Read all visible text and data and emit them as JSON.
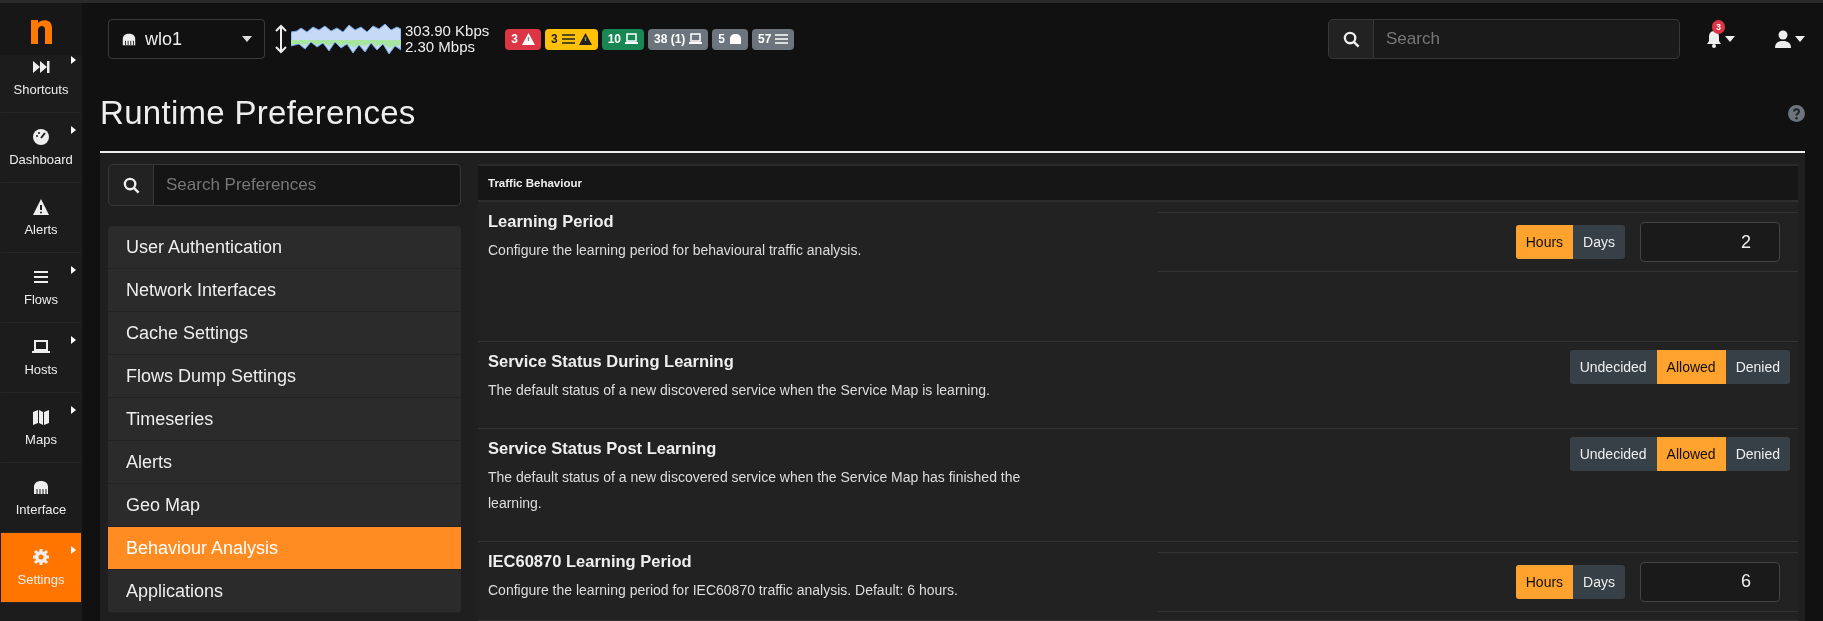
{
  "sidebar": {
    "items": [
      {
        "label": "Shortcuts",
        "submenu": true,
        "selected": false
      },
      {
        "label": "Dashboard",
        "submenu": true,
        "selected": false
      },
      {
        "label": "Alerts",
        "submenu": false,
        "selected": false
      },
      {
        "label": "Flows",
        "submenu": true,
        "selected": false
      },
      {
        "label": "Hosts",
        "submenu": true,
        "selected": false
      },
      {
        "label": "Maps",
        "submenu": true,
        "selected": false
      },
      {
        "label": "Interface",
        "submenu": false,
        "selected": false
      },
      {
        "label": "Settings",
        "submenu": true,
        "selected": true
      }
    ]
  },
  "top_bar": {
    "interface_select": {
      "value": "wlo1"
    },
    "throughput": {
      "upload": "303.90 Kbps",
      "download": "2.30 Mbps"
    },
    "badges": [
      {
        "text": "3",
        "kind": "alert",
        "color": "#dc3545"
      },
      {
        "text": "3",
        "kind": "flow-alert",
        "color": "#ffc107"
      },
      {
        "text": "10",
        "kind": "host",
        "color": "#198754"
      },
      {
        "text": "38 (1)",
        "kind": "host",
        "color": "#6c757d"
      },
      {
        "text": "5",
        "kind": "device",
        "color": "#6c757d"
      },
      {
        "text": "57",
        "kind": "flow",
        "color": "#6c757d"
      }
    ],
    "search": {
      "placeholder": "Search"
    },
    "notifications": {
      "count": "3"
    }
  },
  "page": {
    "title": "Runtime Preferences"
  },
  "preferences_search": {
    "placeholder": "Search Preferences"
  },
  "categories": [
    {
      "label": "User Authentication",
      "selected": false
    },
    {
      "label": "Network Interfaces",
      "selected": false
    },
    {
      "label": "Cache Settings",
      "selected": false
    },
    {
      "label": "Flows Dump Settings",
      "selected": false
    },
    {
      "label": "Timeseries",
      "selected": false
    },
    {
      "label": "Alerts",
      "selected": false
    },
    {
      "label": "Geo Map",
      "selected": false
    },
    {
      "label": "Behaviour Analysis",
      "selected": true
    },
    {
      "label": "Applications",
      "selected": false
    }
  ],
  "section": {
    "title": "Traffic Behaviour",
    "settings": [
      {
        "kind": "period",
        "title": "Learning Period",
        "description": "Configure the learning period for behavioural traffic analysis.",
        "options": [
          {
            "label": "Hours",
            "selected": true
          },
          {
            "label": "Days",
            "selected": false
          }
        ],
        "value": "2"
      },
      {
        "kind": "choice",
        "title": "Service Status During Learning",
        "description": "The default status of a new discovered service when the Service Map is learning.",
        "options": [
          {
            "label": "Undecided",
            "selected": false
          },
          {
            "label": "Allowed",
            "selected": true
          },
          {
            "label": "Denied",
            "selected": false
          }
        ]
      },
      {
        "kind": "choice",
        "title": "Service Status Post Learning",
        "description": "The default status of a new discovered service when the Service Map has finished the learning.",
        "options": [
          {
            "label": "Undecided",
            "selected": false
          },
          {
            "label": "Allowed",
            "selected": true
          },
          {
            "label": "Denied",
            "selected": false
          }
        ]
      },
      {
        "kind": "period",
        "title": "IEC60870 Learning Period",
        "description": "Configure the learning period for IEC60870 traffic analysis. Default: 6 hours.",
        "options": [
          {
            "label": "Hours",
            "selected": true
          },
          {
            "label": "Days",
            "selected": false
          }
        ],
        "value": "6"
      }
    ]
  }
}
